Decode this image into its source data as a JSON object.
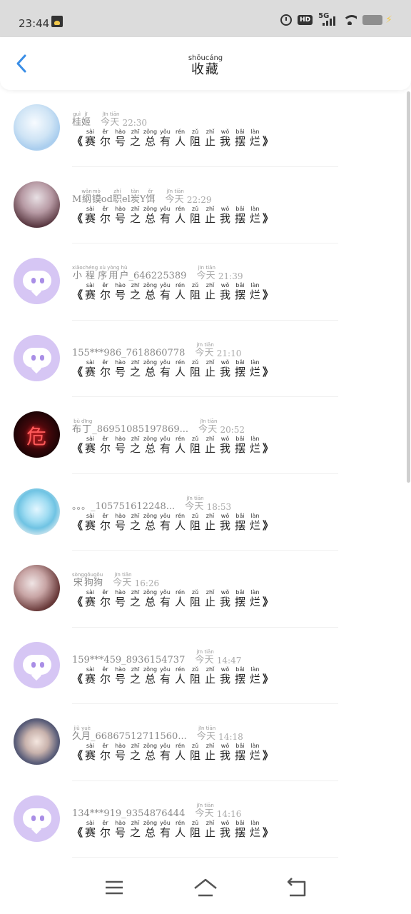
{
  "status_bar": {
    "time": "23:44",
    "network": "5G",
    "hd": "HD",
    "icons": [
      "app-notification-icon",
      "alarm-icon",
      "hd-icon",
      "signal-5g-icon",
      "wifi-icon",
      "battery-icon",
      "charging-icon"
    ]
  },
  "header": {
    "title": "收藏",
    "title_pinyin": "shōucáng",
    "back_icon": "chevron-left-icon",
    "accent": "#3a8ee6"
  },
  "today_label": {
    "chars": [
      "今",
      "天"
    ],
    "pinyin": [
      "jīn",
      "tiān"
    ]
  },
  "content_title": {
    "open": "《",
    "close": "》",
    "chars": [
      "赛",
      "尔",
      "号",
      "之",
      "总",
      "有",
      "人",
      "阻",
      "止",
      "我",
      "摆",
      "烂"
    ],
    "pinyin": [
      "sài",
      "ěr",
      "hào",
      "zhī",
      "zǒng",
      "yǒu",
      "rén",
      "zǔ",
      "zhǐ",
      "wǒ",
      "bǎi",
      "làn"
    ]
  },
  "items": [
    {
      "avatar": "av-1",
      "name": [
        [
          "桂",
          "guì"
        ],
        [
          "姬",
          "jī"
        ]
      ],
      "time": "22:30"
    },
    {
      "avatar": "av-2",
      "name": [
        [
          "M",
          ""
        ],
        [
          "䋄",
          "wǎn"
        ],
        [
          "镆",
          "mò"
        ],
        [
          "od",
          ""
        ],
        [
          "职",
          "zhí"
        ],
        [
          "el",
          ""
        ],
        [
          "炭",
          "tàn"
        ],
        [
          "Y",
          ""
        ],
        [
          "饵",
          "ěr"
        ]
      ],
      "time": "22:29"
    },
    {
      "avatar": "default",
      "name": [
        [
          "小",
          "xiǎo"
        ],
        [
          "程",
          "chéng"
        ],
        [
          "序",
          "xù"
        ],
        [
          "用",
          "yòng"
        ],
        [
          "户",
          "hù"
        ],
        [
          "_646225389",
          ""
        ]
      ],
      "time": "21:39"
    },
    {
      "avatar": "default",
      "name": [
        [
          "155***986_7618860778",
          ""
        ]
      ],
      "time": "21:10"
    },
    {
      "avatar": "av-5",
      "name": [
        [
          "布",
          "bù"
        ],
        [
          "丁",
          "dīng"
        ],
        [
          "_86951085197869...",
          ""
        ]
      ],
      "time": "20:52"
    },
    {
      "avatar": "av-6",
      "name": [
        [
          "。。。_105751612248...",
          ""
        ]
      ],
      "time": "18:53"
    },
    {
      "avatar": "av-7",
      "name": [
        [
          "宋",
          "sòng"
        ],
        [
          "狗",
          "gǒu"
        ],
        [
          "狗",
          "gǒu"
        ]
      ],
      "time": "16:26"
    },
    {
      "avatar": "default",
      "name": [
        [
          "159***459_8936154737",
          ""
        ]
      ],
      "time": "14:47"
    },
    {
      "avatar": "av-9",
      "name": [
        [
          "久",
          "jiǔ"
        ],
        [
          "月",
          "yuè"
        ],
        [
          "_66867512711560...",
          ""
        ]
      ],
      "time": "14:18"
    },
    {
      "avatar": "default",
      "name": [
        [
          "134***919_9354876444",
          ""
        ]
      ],
      "time": "14:16"
    }
  ],
  "nav": {
    "menu": "menu-icon",
    "home": "home-icon",
    "back": "back-icon"
  }
}
